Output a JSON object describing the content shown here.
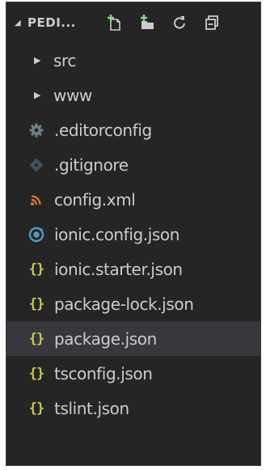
{
  "explorer": {
    "project_title": "PEDI...",
    "actions": [
      {
        "icon": "new-file-icon"
      },
      {
        "icon": "new-folder-icon"
      },
      {
        "icon": "refresh-icon"
      },
      {
        "icon": "collapse-all-icon"
      }
    ]
  },
  "tree": {
    "folders": [
      {
        "label": "src"
      },
      {
        "label": "www"
      }
    ],
    "files": [
      {
        "label": ".editorconfig",
        "icon": "gear-icon",
        "color": "#6d8086"
      },
      {
        "label": ".gitignore",
        "icon": "git-diamond-icon",
        "color": "#41535b"
      },
      {
        "label": "config.xml",
        "icon": "rss-icon",
        "color": "#e37933"
      },
      {
        "label": "ionic.config.json",
        "icon": "ionic-icon",
        "color": "#519aba"
      },
      {
        "label": "ionic.starter.json",
        "icon": "json-braces-icon",
        "color": "#cbcb41"
      },
      {
        "label": "package-lock.json",
        "icon": "json-braces-icon",
        "color": "#cbcb41"
      },
      {
        "label": "package.json",
        "icon": "json-braces-icon",
        "color": "#cbcb41",
        "selected": true
      },
      {
        "label": "tsconfig.json",
        "icon": "json-braces-icon",
        "color": "#cbcb41"
      },
      {
        "label": "tslint.json",
        "icon": "json-braces-icon",
        "color": "#cbcb41"
      }
    ]
  },
  "colors": {
    "panel_bg": "#252526",
    "selected_bg": "#37373d",
    "text": "#cccccc",
    "accent_green": "#89d185"
  }
}
